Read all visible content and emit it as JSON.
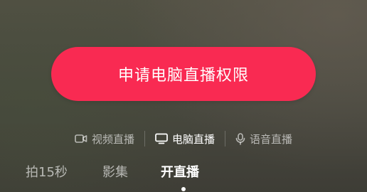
{
  "apply_button": {
    "label": "申请电脑直播权限"
  },
  "live_modes": [
    {
      "label": "视频直播",
      "icon": "video-camera-icon",
      "active": false
    },
    {
      "label": "电脑直播",
      "icon": "monitor-icon",
      "active": true
    },
    {
      "label": "语音直播",
      "icon": "microphone-icon",
      "active": false
    }
  ],
  "bottom_tabs": [
    {
      "label": "拍15秒",
      "active": false
    },
    {
      "label": "影集",
      "active": false
    },
    {
      "label": "开直播",
      "active": true
    }
  ],
  "colors": {
    "accent": "#f92a52",
    "active_text": "#ffffff",
    "inactive_text": "rgba(255,255,255,0.62)"
  }
}
